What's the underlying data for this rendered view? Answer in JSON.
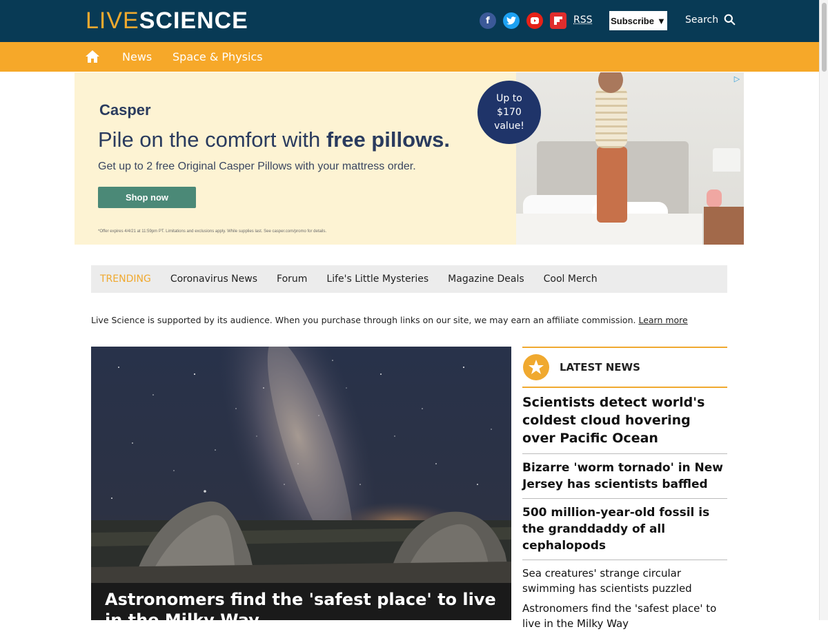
{
  "header": {
    "logo_live": "LIVE",
    "logo_science": "SCIENCE",
    "rss": "RSS",
    "subscribe": "Subscribe",
    "subscribe_caret": "▼",
    "search": "Search",
    "social": [
      "facebook",
      "twitter",
      "youtube",
      "flipboard"
    ]
  },
  "nav": {
    "items": [
      "News",
      "Space & Physics"
    ]
  },
  "ad": {
    "brand": "Casper",
    "headline_regular": "Pile on the comfort with ",
    "headline_bold": "free pillows.",
    "subhead": "Get up to 2 free Original Casper Pillows with your mattress order.",
    "button": "Shop now",
    "badge": "Up to\n$170\nvalue!",
    "fine_print": "*Offer expires 4/4/21 at 11:59pm PT. Limitations and exclusions apply. While supplies last. See casper.com/promo for details.",
    "choices_icon": "▷"
  },
  "trending": {
    "label": "TRENDING",
    "items": [
      "Coronavirus News",
      "Forum",
      "Life's Little Mysteries",
      "Magazine Deals",
      "Cool Merch"
    ]
  },
  "disclosure": {
    "text": "Live Science is supported by its audience. When you purchase through links on our site, we may earn an affiliate commission. ",
    "link": "Learn more"
  },
  "hero": {
    "title": "Astronomers find the 'safest place' to live in the Milky Way"
  },
  "latest_news": {
    "label": "LATEST NEWS",
    "items": [
      "Scientists detect world's coldest cloud hovering over Pacific Ocean",
      "Bizarre 'worm tornado' in New Jersey has scientists baffled",
      "500 million-year-old fossil is the granddaddy of all cephalopods",
      "Sea creatures' strange circular swimming has scientists puzzled",
      "Astronomers find the 'safest place' to live in the Milky Way"
    ]
  },
  "colors": {
    "header_bg": "#083a55",
    "nav_bg": "#f6a829",
    "accent": "#f0a92f"
  }
}
